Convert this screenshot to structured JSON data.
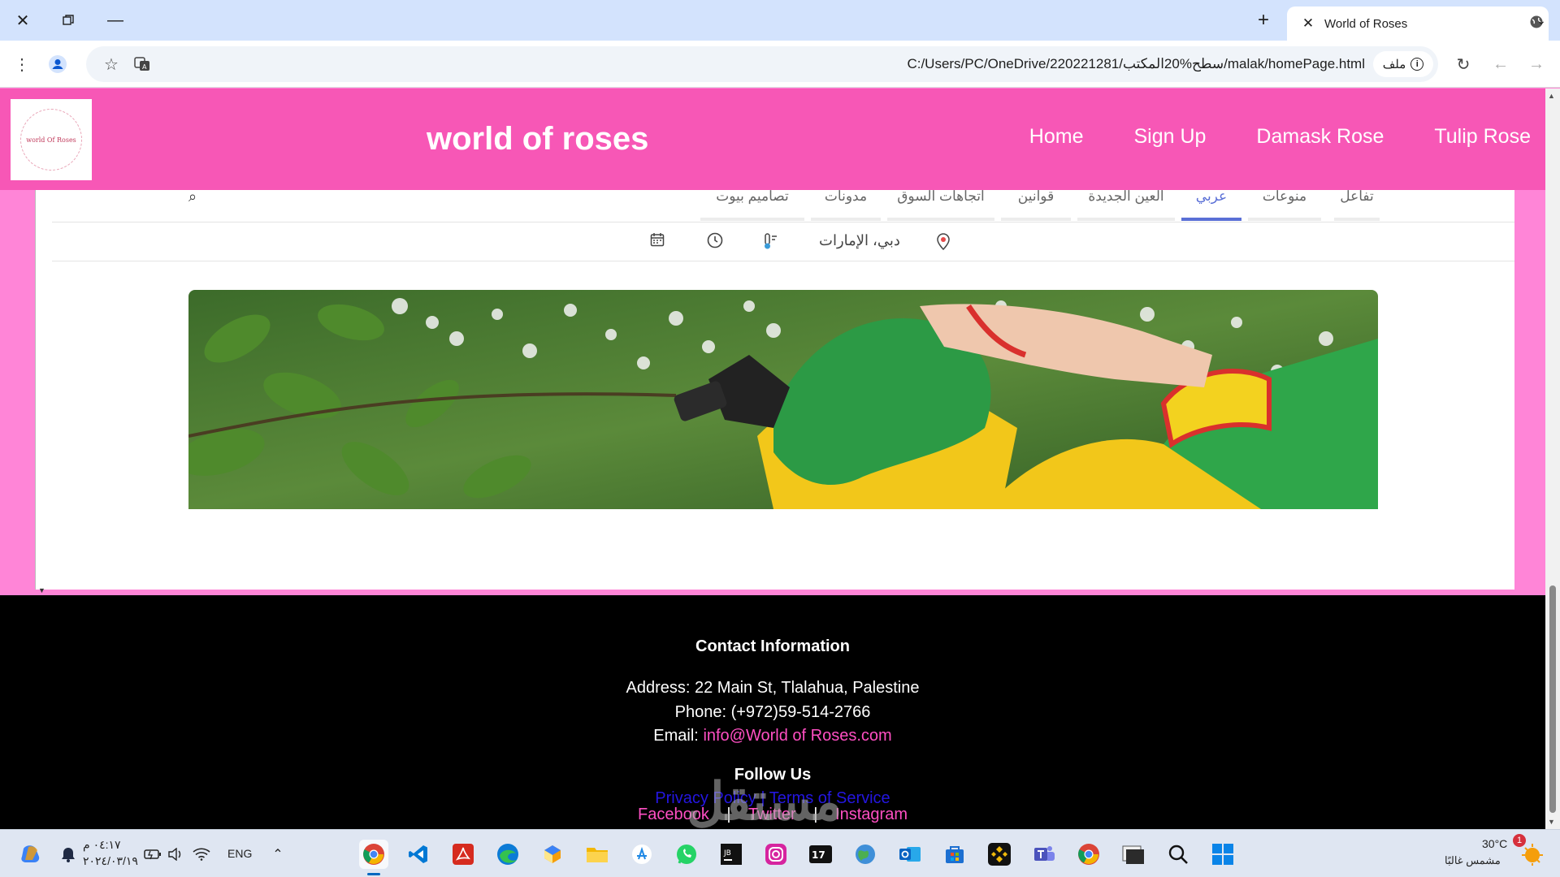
{
  "browser": {
    "tab_title": "World of Roses",
    "url": "C:/Users/PC/OneDrive/220221281/سطح%20المكتب/malak/homePage.html",
    "url_chip": "ملف"
  },
  "site": {
    "title": "world of roses",
    "logo_text": "world Of Roses",
    "nav": [
      "Home",
      "Sign Up",
      "Damask Rose",
      "Tulip Rose"
    ]
  },
  "iframe": {
    "categories": [
      "تفاعل",
      "منوعات",
      "عربي",
      "العين الجديدة",
      "قوانين",
      "اتجاهات السوق",
      "مدونات",
      "تصاميم بيوت"
    ],
    "active_category": "عربي",
    "location": "دبي، الإمارات"
  },
  "footer": {
    "contact_heading": "Contact Information",
    "address": "Address: 22 Main St, Tlalahua, Palestine",
    "phone": "Phone: (+972)59-514-2766",
    "email_label": "Email:",
    "email": "info@World of Roses.com",
    "follow_heading": "Follow Us",
    "social": [
      "Facebook",
      "Twitter",
      "Instagram"
    ],
    "separator": "|",
    "privacy": "Privacy Policy",
    "terms": "Terms of Service"
  },
  "watermark": "مستقل",
  "taskbar": {
    "time": "٠٤:١٧ م",
    "date": "٢٠٢٤/٠٣/١٩",
    "language": "ENG",
    "temperature": "30°C",
    "weather": "مشمس غالبًا",
    "notification_count": "1",
    "pinned_apps": [
      "chrome-icon",
      "vscode-icon",
      "acrobat-icon",
      "edge-icon",
      "cube-app-icon",
      "files-icon",
      "appstore-icon",
      "whatsapp-icon",
      "jetbrains-icon",
      "instagram-icon",
      "tradingview-icon",
      "earth-icon",
      "outlook-icon",
      "store-icon",
      "binance-icon",
      "teams-icon",
      "chrome-alt-icon",
      "terminal-icon",
      "search-icon",
      "windows-icon"
    ]
  }
}
